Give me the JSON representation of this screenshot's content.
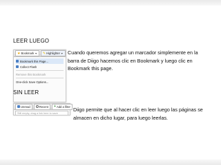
{
  "sections": [
    {
      "heading": "LEER LUEGO",
      "description": "Cuando queremos agregar un marcador simplemente en la barra de Diigo hacemos clic en Bookmark y luego clic en Bookmark this page."
    },
    {
      "heading": "SIN LEER",
      "description": "Diigo permite que al hacer clic en leer luego las páginas se almacen en dicho lugar, para luego leerlas."
    }
  ],
  "bookmark_shot": {
    "bookmark_btn": "Bookmark",
    "highlighter_btn": "Highlighter",
    "menu": [
      "Bookmark this Page...",
      "Collect Flash",
      "Remove this Bookmark",
      "One-click Save Options..."
    ]
  },
  "readlater_shot": {
    "unread_btn": "Unread",
    "recent_btn": "Recent",
    "add_filter_btn": "Add a filter",
    "empty_text": "Still empty, drag a link here to save"
  },
  "colors": {
    "background": "#ffffff",
    "text": "#111111",
    "menu_highlight": "#dbe8f8",
    "icon_blue": "#4a7fc4"
  }
}
